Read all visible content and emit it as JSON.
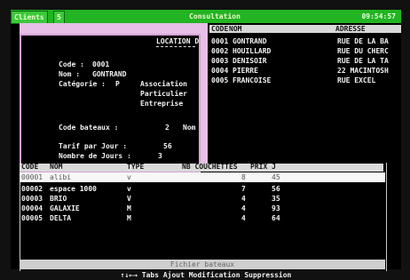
{
  "topbar": {
    "tab_clients": "Clients",
    "tab_count": "5",
    "title": "Consultation",
    "clock": "09:54:57"
  },
  "detail": {
    "heading": "LOCATION D",
    "code_label": "Code :",
    "code_value": "0001",
    "nom_label": "Nom :",
    "nom_value": "GONTRAND",
    "categorie_label": "Catégorie :",
    "categorie_value": "P",
    "categorie_options": [
      "Association",
      "Particulier",
      "Entreprise"
    ],
    "bateaux_label": "Code bateaux :",
    "bateaux_value": "2",
    "bateaux_nom": "Nom",
    "tarif_label": "Tarif par Jour :",
    "tarif_value": "56",
    "jours_label": "Nombre de Jours :",
    "jours_value": "3"
  },
  "clients_list": {
    "headers": [
      "CODE",
      "NOM",
      "ADRESSE"
    ],
    "rows": [
      {
        "code": "0001",
        "nom": "GONTRAND",
        "adresse": "RUE DE LA BA"
      },
      {
        "code": "0002",
        "nom": "HOUILLARD",
        "adresse": "RUE DU CHERC"
      },
      {
        "code": "0003",
        "nom": "DENISOIR",
        "adresse": "RUE DE LA TA"
      },
      {
        "code": "0004",
        "nom": "PIERRE",
        "adresse": "22 MACINTOSH"
      },
      {
        "code": "0005",
        "nom": "FRANCOISE",
        "adresse": "RUE EXCEL"
      }
    ]
  },
  "boats_table": {
    "headers": [
      "CODE",
      "NOM",
      "TYPE",
      "NB COUCHETTES",
      "PRIX J"
    ],
    "rows": [
      {
        "code": "00001",
        "nom": "alibi",
        "type": "v",
        "couchettes": "8",
        "prix": "45"
      },
      {
        "code": "00002",
        "nom": "espace 1000",
        "type": "v",
        "couchettes": "7",
        "prix": "56"
      },
      {
        "code": "00003",
        "nom": "BRIO",
        "type": "V",
        "couchettes": "4",
        "prix": "35"
      },
      {
        "code": "00004",
        "nom": "GALAXIE",
        "type": "M",
        "couchettes": "4",
        "prix": "93"
      },
      {
        "code": "00005",
        "nom": "DELTA",
        "type": "M",
        "couchettes": "4",
        "prix": "64"
      }
    ]
  },
  "status": "Fichier bateaux",
  "fkeys": "↑↓←→ Tabs  Ajout  Modification  Suppression",
  "colors": {
    "topbar": "#22b422",
    "detail_border": "#d7a2d7",
    "header_bg": "#d9d9d9",
    "background": "#000000"
  }
}
